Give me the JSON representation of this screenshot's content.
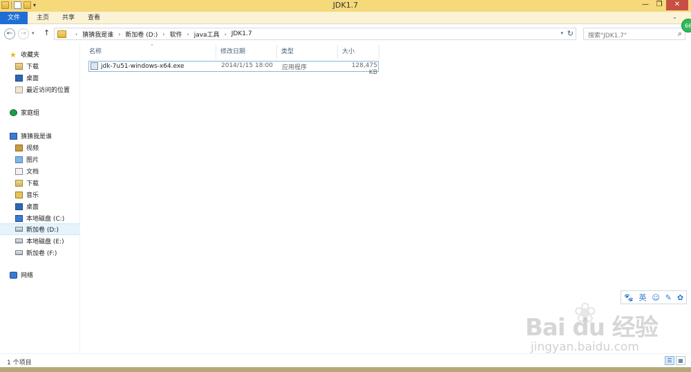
{
  "window": {
    "title": "JDK1.7",
    "minimize_glyph": "—",
    "restore_glyph": "❐",
    "close_glyph": "✕"
  },
  "ribbon": {
    "tabs": [
      {
        "label": "文件"
      },
      {
        "label": "主页"
      },
      {
        "label": "共享"
      },
      {
        "label": "查看"
      }
    ],
    "collapse_glyph": "⌄"
  },
  "address": {
    "breadcrumbs": [
      "猜猜我是谁",
      "新加卷 (D:)",
      "软件",
      "java工具",
      "JDK1.7"
    ],
    "separator": "›",
    "search_placeholder": "搜索\"JDK1.7\""
  },
  "badge": {
    "text": "66"
  },
  "sidebar": {
    "favorites": {
      "label": "收藏夹",
      "items": [
        {
          "label": "下载"
        },
        {
          "label": "桌面"
        },
        {
          "label": "最近访问的位置"
        }
      ]
    },
    "homegroup": {
      "label": "家庭组"
    },
    "pc": {
      "label": "猜猜我是谁",
      "items": [
        {
          "label": "视频"
        },
        {
          "label": "图片"
        },
        {
          "label": "文档"
        },
        {
          "label": "下载"
        },
        {
          "label": "音乐"
        },
        {
          "label": "桌面"
        },
        {
          "label": "本地磁盘 (C:)"
        },
        {
          "label": "新加卷 (D:)"
        },
        {
          "label": "本地磁盘 (E:)"
        },
        {
          "label": "新加卷 (F:)"
        }
      ]
    },
    "network": {
      "label": "网络"
    }
  },
  "columns": {
    "name": "名称",
    "date": "修改日期",
    "type": "类型",
    "size": "大小"
  },
  "files": [
    {
      "name": "jdk-7u51-windows-x64.exe",
      "date": "2014/1/15 18:00",
      "type": "应用程序",
      "size": "128,475 KB"
    }
  ],
  "ime_toolbar": {
    "items": [
      "🐾",
      "英",
      "☺",
      "✎",
      "✿"
    ]
  },
  "watermark": {
    "logo": "Bai du 经验",
    "url": "jingyan.baidu.com"
  },
  "status": {
    "count_text": "1 个项目"
  },
  "colors": {
    "accent": "#1f6ed4",
    "titlebar": "#f5d97a",
    "selection": "#e5f3fb",
    "close": "#c74f43"
  }
}
